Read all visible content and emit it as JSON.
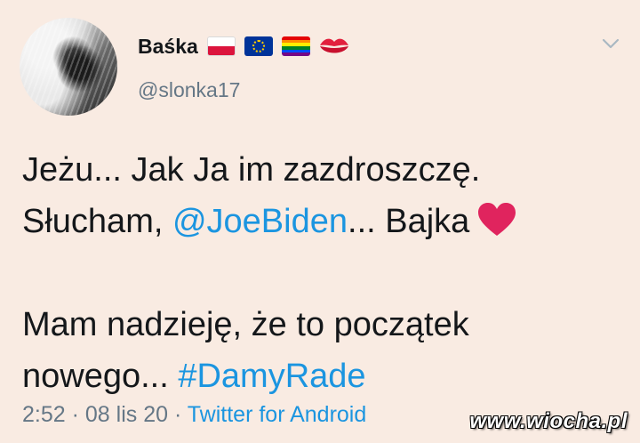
{
  "author": {
    "display_name": "Baśka",
    "handle": "@slonka17",
    "name_emojis": [
      "flag-poland-icon",
      "flag-eu-icon",
      "rainbow-flag-icon",
      "kiss-lips-icon"
    ]
  },
  "tweet": {
    "line1": "Jeżu... Jak Ja im zazdroszczę.",
    "line2_prefix": "Słucham, ",
    "mention": "@JoeBiden",
    "line2_mid": "... Bajka",
    "line3": "Mam nadzieję, że to początek",
    "line4_prefix": "nowego... ",
    "hashtag": "#DamyRade"
  },
  "meta": {
    "time": "2:52",
    "sep1": " · ",
    "date": "08 lis 20",
    "sep2": " · ",
    "source": "Twitter for Android"
  },
  "watermark": "www.wiocha.pl",
  "colors": {
    "background": "#f9ebe2",
    "link": "#1b95e0",
    "muted": "#657786",
    "heart": "#e0245e"
  }
}
